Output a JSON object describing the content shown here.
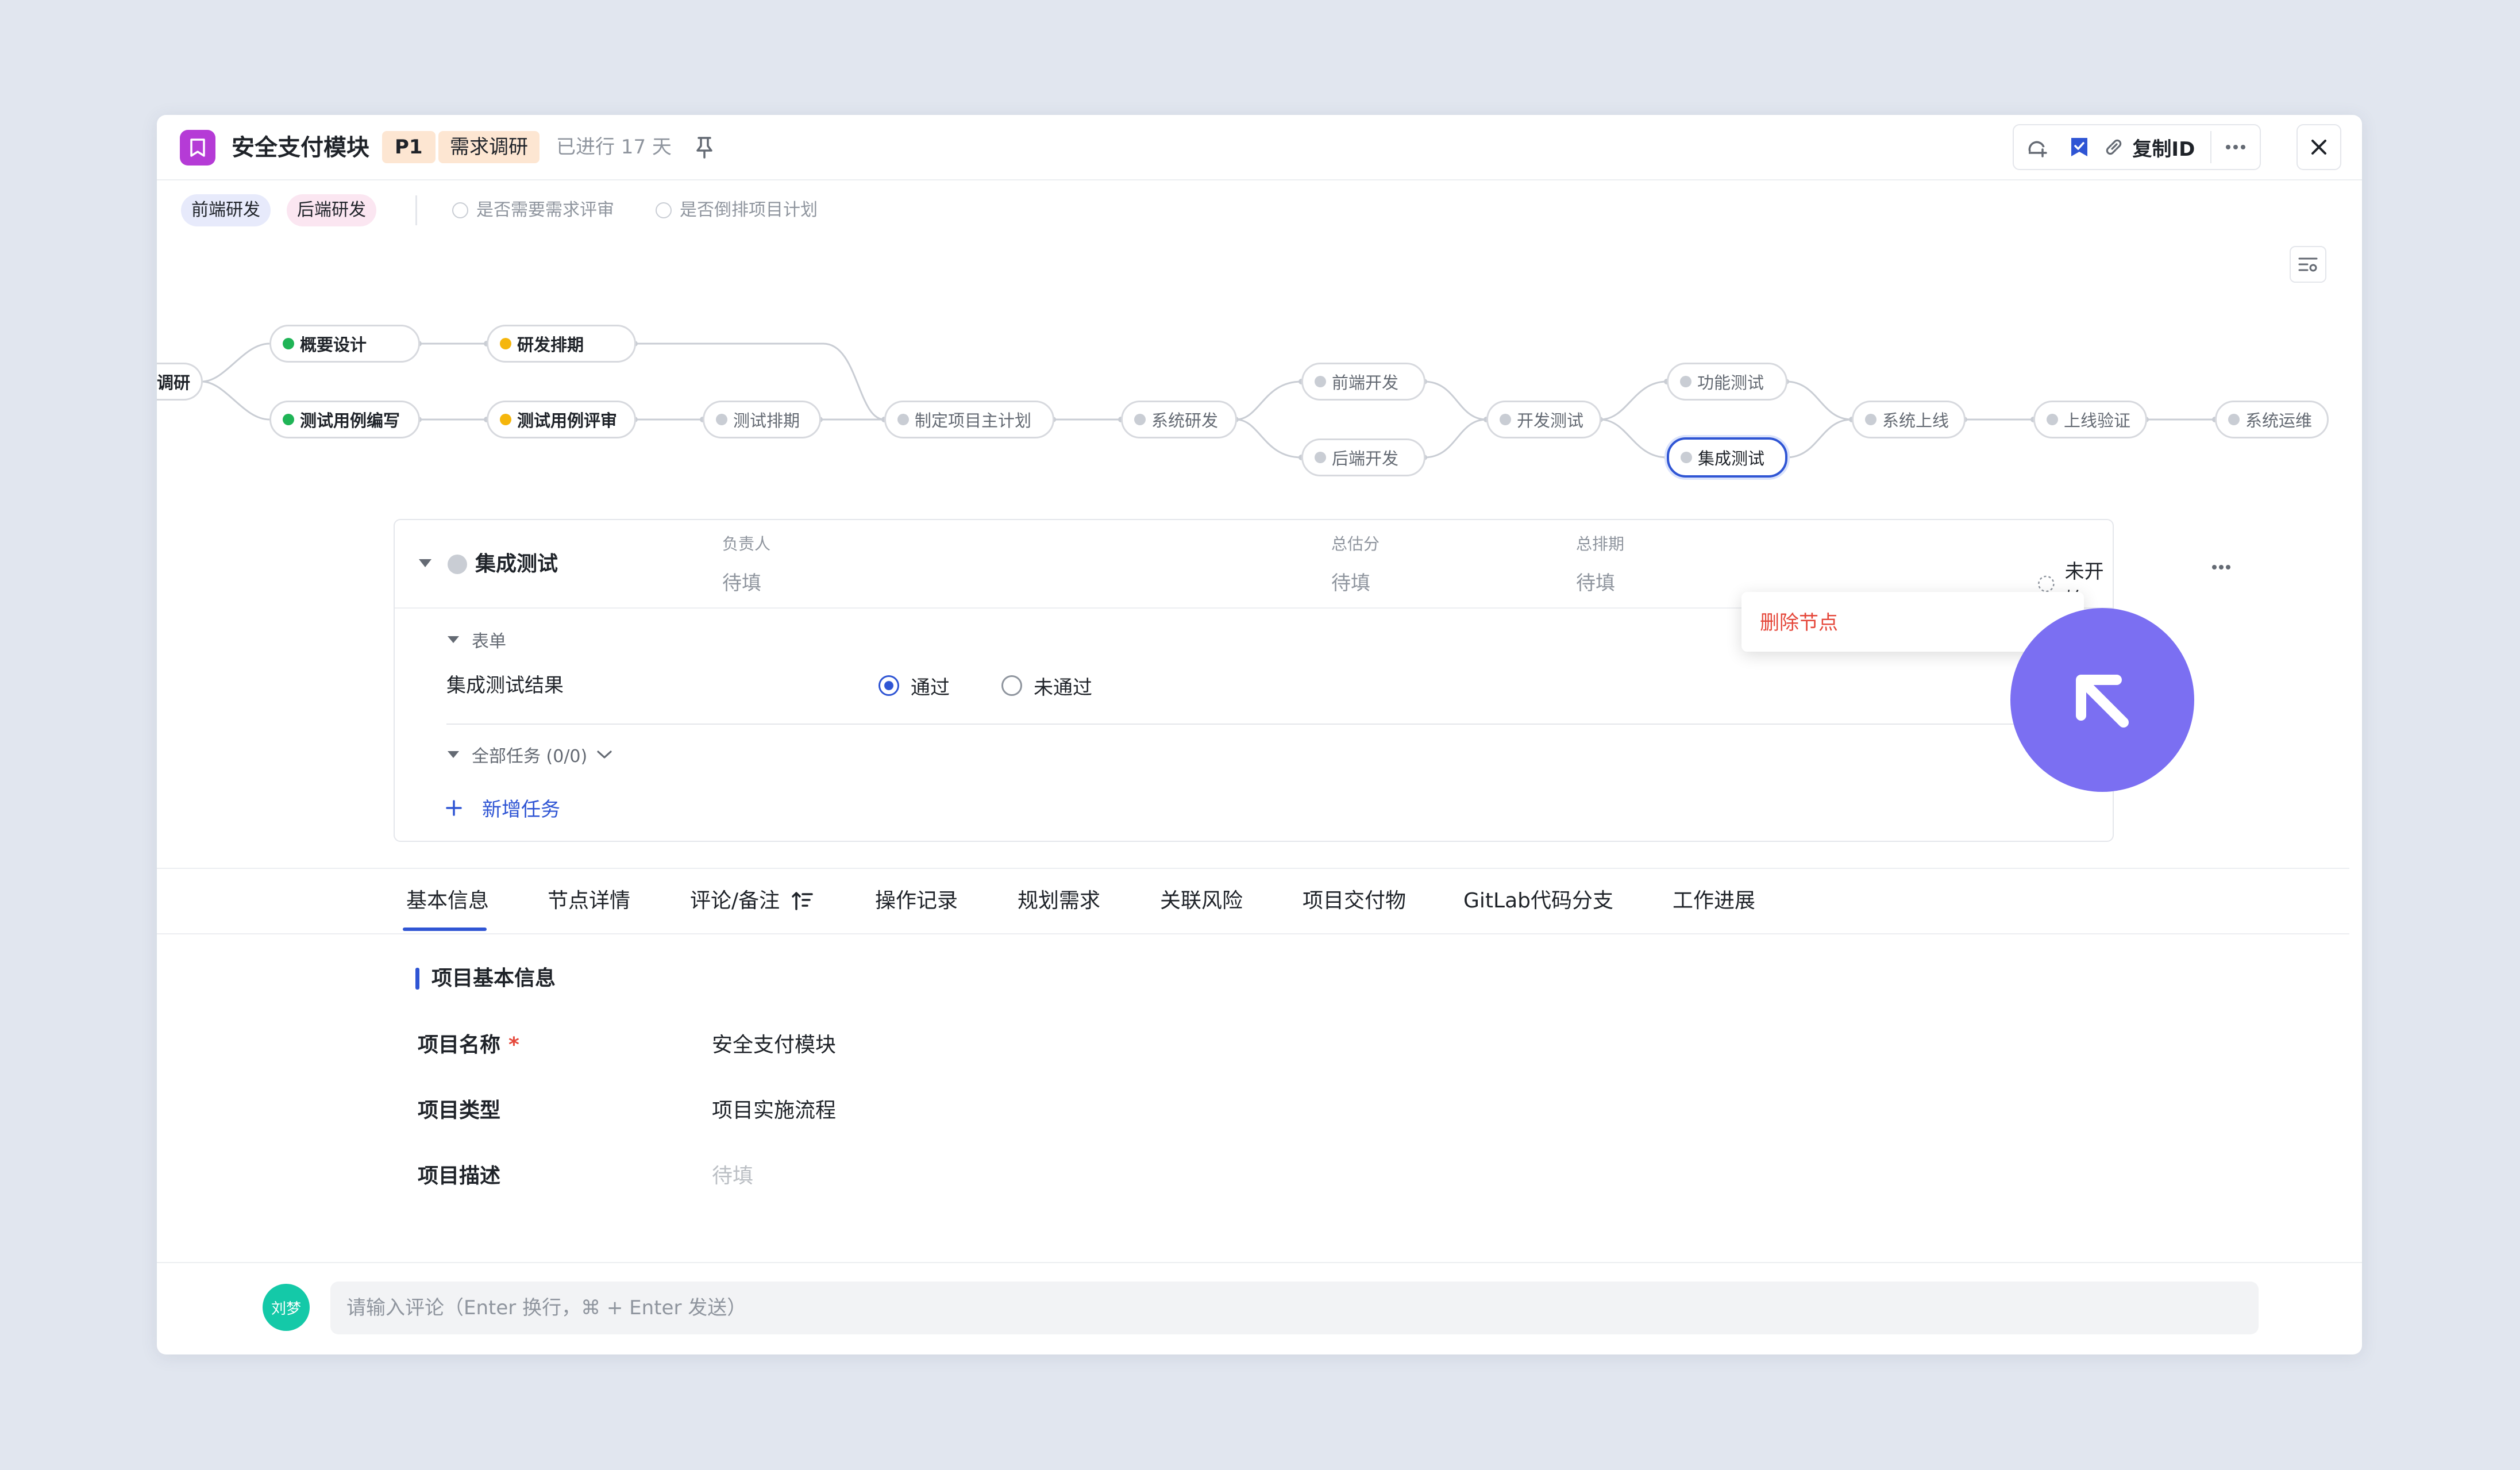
{
  "header": {
    "app_icon": "bookmark-icon",
    "title": "安全支付模块",
    "priority": "P1",
    "stage": "需求调研",
    "elapsed": "已进行 17 天",
    "copy_id_label": "复制ID"
  },
  "subheader": {
    "tags": [
      "前端研发",
      "后端研发"
    ],
    "options": [
      "是否需要需求评审",
      "是否倒排项目计划"
    ]
  },
  "flow": {
    "nodes": {
      "n0": "调研",
      "n1": "概要设计",
      "n2": "研发排期",
      "n3": "测试用例编写",
      "n4": "测试用例评审",
      "n5": "测试排期",
      "n6": "制定项目主计划",
      "n7": "系统研发",
      "n8": "前端开发",
      "n9": "后端开发",
      "n10": "开发测试",
      "n11": "功能测试",
      "n12": "集成测试",
      "n13": "系统上线",
      "n14": "上线验证",
      "n15": "系统运维"
    }
  },
  "node_detail": {
    "name": "集成测试",
    "owner_label": "负责人",
    "owner_value": "待填",
    "estimate_label": "总估分",
    "estimate_value": "待填",
    "schedule_label": "总排期",
    "schedule_value": "待填",
    "status": "未开始",
    "form_label": "表单",
    "field_label": "集成测试结果",
    "options": [
      "通过",
      "未通过"
    ],
    "selected_option": "通过",
    "tasks_label": "全部任务 (0/0)",
    "add_task_label": "新增任务",
    "menu_item": "删除节点"
  },
  "tabs": [
    "基本信息",
    "节点详情",
    "评论/备注",
    "操作记录",
    "规划需求",
    "关联风险",
    "项目交付物",
    "GitLab代码分支",
    "工作进展"
  ],
  "active_tab": "基本信息",
  "basic_info": {
    "section_title": "项目基本信息",
    "fields": [
      {
        "label": "项目名称",
        "value": "安全支付模块",
        "required": "*"
      },
      {
        "label": "项目类型",
        "value": "项目实施流程"
      },
      {
        "label": "项目描述",
        "value": "待填"
      }
    ]
  },
  "comment": {
    "avatar_text": "刘梦",
    "placeholder": "请输入评论（Enter 换行，⌘ + Enter 发送）"
  },
  "colors": {
    "accent": "#2f55d4",
    "done": "#1fb456",
    "in_progress": "#f5b60c",
    "danger": "#e5473a",
    "cursor": "#7b6ff2"
  }
}
